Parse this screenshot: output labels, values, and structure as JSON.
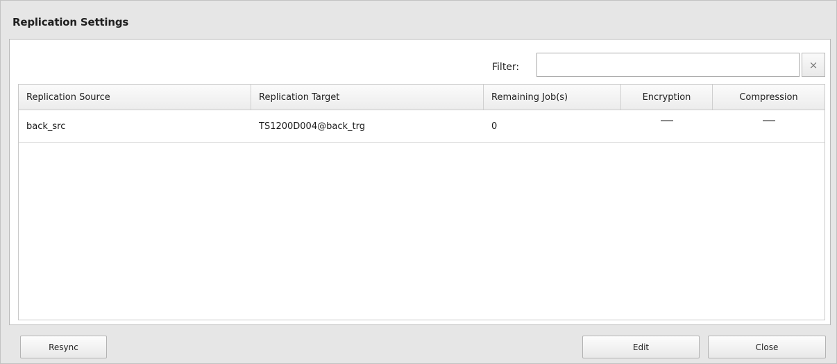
{
  "dialog": {
    "title": "Replication Settings"
  },
  "filter": {
    "label": "Filter:",
    "value": "",
    "placeholder": "",
    "clear_icon": "×"
  },
  "table": {
    "columns": [
      "Replication Source",
      "Replication Target",
      "Remaining Job(s)",
      "Encryption",
      "Compression"
    ],
    "rows": [
      {
        "source": "back_src",
        "target": "TS1200D004@back_trg",
        "remaining": "0",
        "encryption": "dash-icon",
        "compression": "dash-icon"
      }
    ]
  },
  "buttons": {
    "resync": "Resync",
    "edit": "Edit",
    "close": "Close"
  }
}
